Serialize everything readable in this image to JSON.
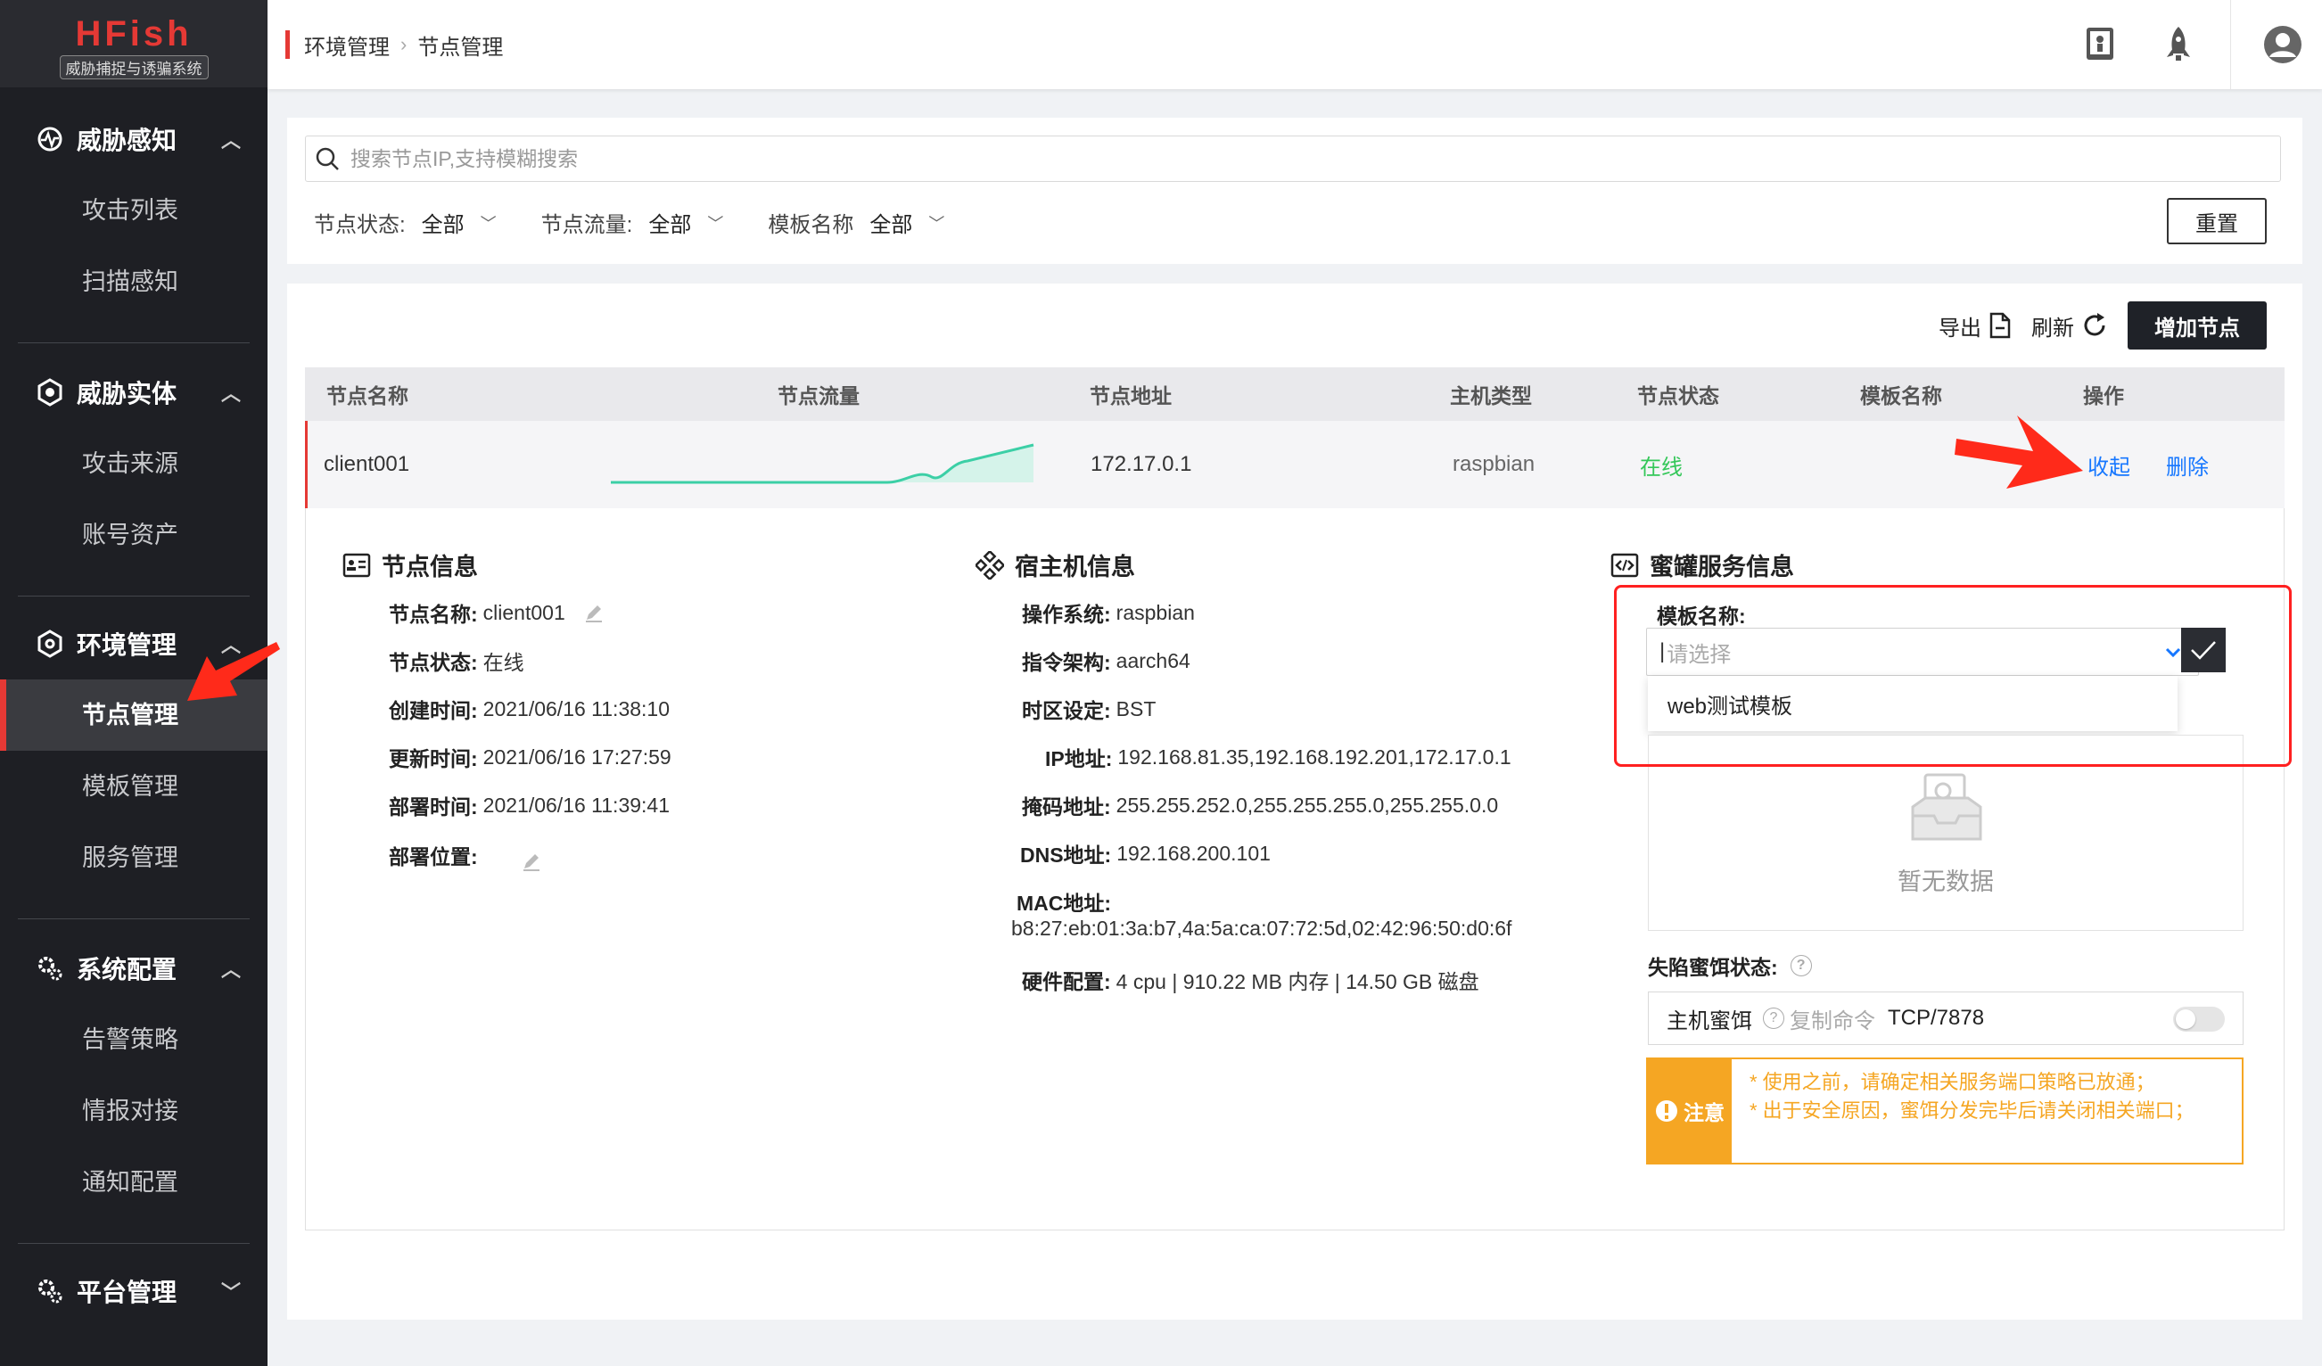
{
  "app": {
    "name": "HFish",
    "subtitle": "威胁捕捉与诱骗系统"
  },
  "sidebar": {
    "groups": [
      {
        "label": "威胁感知",
        "icon": "radar-icon",
        "expanded": true,
        "items": [
          "攻击列表",
          "扫描感知"
        ]
      },
      {
        "label": "威胁实体",
        "icon": "shield-icon",
        "expanded": true,
        "items": [
          "攻击来源",
          "账号资产"
        ]
      },
      {
        "label": "环境管理",
        "icon": "environment-icon",
        "expanded": true,
        "items": [
          "节点管理",
          "模板管理",
          "服务管理"
        ],
        "active_item": "节点管理"
      },
      {
        "label": "系统配置",
        "icon": "gears-icon",
        "expanded": true,
        "items": [
          "告警策略",
          "情报对接",
          "通知配置"
        ]
      },
      {
        "label": "平台管理",
        "icon": "gears-icon",
        "expanded": false,
        "items": []
      }
    ]
  },
  "breadcrumb": [
    "环境管理",
    "节点管理"
  ],
  "topbar_icons": [
    "manual-icon",
    "rocket-icon",
    "user-avatar-icon"
  ],
  "search": {
    "placeholder": "搜索节点IP,支持模糊搜索",
    "value": ""
  },
  "filters": [
    {
      "label": "节点状态:",
      "value": "全部"
    },
    {
      "label": "节点流量:",
      "value": "全部"
    },
    {
      "label": "模板名称",
      "value": "全部"
    }
  ],
  "reset_label": "重置",
  "toolbar": {
    "export_label": "导出",
    "refresh_label": "刷新",
    "add_label": "增加节点"
  },
  "table": {
    "columns": [
      "节点名称",
      "节点流量",
      "节点地址",
      "主机类型",
      "节点状态",
      "模板名称",
      "操作"
    ],
    "rows": [
      {
        "name": "client001",
        "address": "172.17.0.1",
        "host_type": "raspbian",
        "status": "在线",
        "template": "",
        "actions": [
          "收起",
          "删除"
        ]
      }
    ]
  },
  "node_info": {
    "title": "节点信息",
    "fields": [
      {
        "k": "节点名称:",
        "v": "client001",
        "editable": true
      },
      {
        "k": "节点状态:",
        "v": "在线"
      },
      {
        "k": "创建时间:",
        "v": "2021/06/16 11:38:10"
      },
      {
        "k": "更新时间:",
        "v": "2021/06/16 17:27:59"
      },
      {
        "k": "部署时间:",
        "v": "2021/06/16 11:39:41"
      },
      {
        "k": "部署位置:",
        "v": "",
        "editable": true
      }
    ]
  },
  "host_info": {
    "title": "宿主机信息",
    "fields": [
      {
        "k": "操作系统:",
        "v": "raspbian"
      },
      {
        "k": "指令架构:",
        "v": "aarch64"
      },
      {
        "k": "时区设定:",
        "v": "BST"
      },
      {
        "k": "IP地址:",
        "v": "192.168.81.35,192.168.192.201,172.17.0.1"
      },
      {
        "k": "掩码地址:",
        "v": "255.255.252.0,255.255.255.0,255.255.0.0"
      },
      {
        "k": "DNS地址:",
        "v": "192.168.200.101"
      },
      {
        "k": "MAC地址:",
        "v": "b8:27:eb:01:3a:b7,4a:5a:ca:07:72:5d,02:42:96:50:d0:6f"
      },
      {
        "k": "硬件配置:",
        "v": "4 cpu | 910.22 MB 内存 | 14.50 GB 磁盘"
      }
    ]
  },
  "honeypot_info": {
    "title": "蜜罐服务信息",
    "template_label": "模板名称:",
    "select_placeholder": "请选择",
    "dropdown_options": [
      "web测试模板"
    ],
    "empty_text": "暂无数据",
    "bait_status_label": "失陷蜜饵状态:",
    "bait": {
      "name": "主机蜜饵",
      "copy_label": "复制命令",
      "port": "TCP/7878",
      "enabled": false
    },
    "notice": {
      "badge": "注意",
      "lines": [
        "* 使用之前，请确定相关服务端口策略已放通；",
        "* 出于安全原因，蜜饵分发完毕后请关闭相关端口；"
      ]
    }
  },
  "colors": {
    "accent_red": "#e53935",
    "link_blue": "#1677ff",
    "online_green": "#34c759",
    "warning_orange": "#f5a623",
    "sidebar_bg": "#1e1f24",
    "sparkline": "#3ccfa6"
  }
}
